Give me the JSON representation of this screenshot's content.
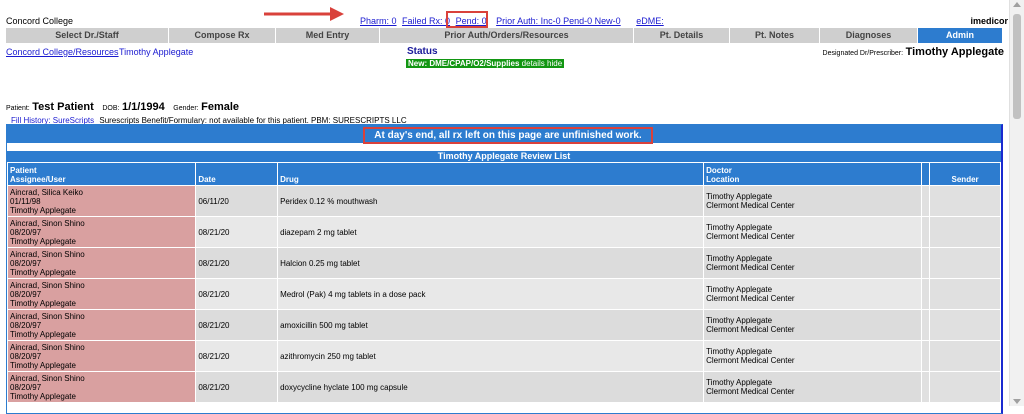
{
  "brand": "Concord College",
  "top_links": {
    "pharm": "Pharm: 0",
    "failed": "Failed Rx: 0",
    "pend": "Pend: 0",
    "prior_auth": "Prior Auth: Inc-0 Pend-0 New-0",
    "edme": "eDME:"
  },
  "app_name": "imedicor",
  "tabs": [
    {
      "label": "Select Dr./Staff"
    },
    {
      "label": "Compose Rx"
    },
    {
      "label": "Med Entry"
    },
    {
      "label": "Prior Auth/Orders/Resources"
    },
    {
      "label": "Pt. Details"
    },
    {
      "label": "Pt. Notes"
    },
    {
      "label": "Diagnoses"
    },
    {
      "label": "Admin",
      "active": true
    }
  ],
  "org_link": "Concord College/Resources",
  "doctor_link": "Timothy Applegate",
  "status": {
    "title": "Status",
    "new_label": "New: DME/CPAP/O2/Supplies",
    "details": "details",
    "hide": "hide"
  },
  "designated": {
    "label": "Designated Dr/Prescriber:",
    "name": "Timothy Applegate"
  },
  "patient": {
    "label": "Patient:",
    "name": "Test Patient",
    "dob_label": "DOB:",
    "dob": "1/1/1994",
    "gender_label": "Gender:",
    "gender": "Female"
  },
  "fill_history": {
    "link": "Fill History: SureScripts",
    "note": "Surescripts Benefit/Formulary: not available for this patient. PBM: SURESCRIPTS LLC"
  },
  "warning": "At day's end, all rx left on this page are unfinished work.",
  "review_title": "Timothy Applegate Review List",
  "columns": {
    "patient": "Patient",
    "assignee": "Assignee/User",
    "date": "Date",
    "drug": "Drug",
    "doctor": "Doctor",
    "location": "Location",
    "sender": "Sender"
  },
  "rows": [
    {
      "patient": "Aincrad, Silica Keiko",
      "dob": "01/11/98",
      "user": "Timothy Applegate",
      "date": "06/11/20",
      "drug": "Peridex 0.12 % mouthwash",
      "doctor": "Timothy Applegate",
      "location": "Clermont Medical Center"
    },
    {
      "patient": "Aincrad, Sinon Shino",
      "dob": "08/20/97",
      "user": "Timothy Applegate",
      "date": "08/21/20",
      "drug": "diazepam 2 mg tablet",
      "doctor": "Timothy Applegate",
      "location": "Clermont Medical Center"
    },
    {
      "patient": "Aincrad, Sinon Shino",
      "dob": "08/20/97",
      "user": "Timothy Applegate",
      "date": "08/21/20",
      "drug": "Halcion 0.25 mg tablet",
      "doctor": "Timothy Applegate",
      "location": "Clermont Medical Center"
    },
    {
      "patient": "Aincrad, Sinon Shino",
      "dob": "08/20/97",
      "user": "Timothy Applegate",
      "date": "08/21/20",
      "drug": "Medrol (Pak) 4 mg tablets in a dose pack",
      "doctor": "Timothy Applegate",
      "location": "Clermont Medical Center"
    },
    {
      "patient": "Aincrad, Sinon Shino",
      "dob": "08/20/97",
      "user": "Timothy Applegate",
      "date": "08/21/20",
      "drug": "amoxicillin 500 mg tablet",
      "doctor": "Timothy Applegate",
      "location": "Clermont Medical Center"
    },
    {
      "patient": "Aincrad, Sinon Shino",
      "dob": "08/20/97",
      "user": "Timothy Applegate",
      "date": "08/21/20",
      "drug": "azithromycin 250 mg tablet",
      "doctor": "Timothy Applegate",
      "location": "Clermont Medical Center"
    },
    {
      "patient": "Aincrad, Sinon Shino",
      "dob": "08/20/97",
      "user": "Timothy Applegate",
      "date": "08/21/20",
      "drug": "doxycycline hyclate 100 mg capsule",
      "doctor": "Timothy Applegate",
      "location": "Clermont Medical Center"
    }
  ],
  "colors": {
    "accent": "#2d7ccf",
    "highlight": "#d9413b",
    "patient_cell": "#d9a0a0",
    "new_bar": "#129612"
  },
  "annotation": {
    "arrow_icon": "red-arrow-icon"
  }
}
